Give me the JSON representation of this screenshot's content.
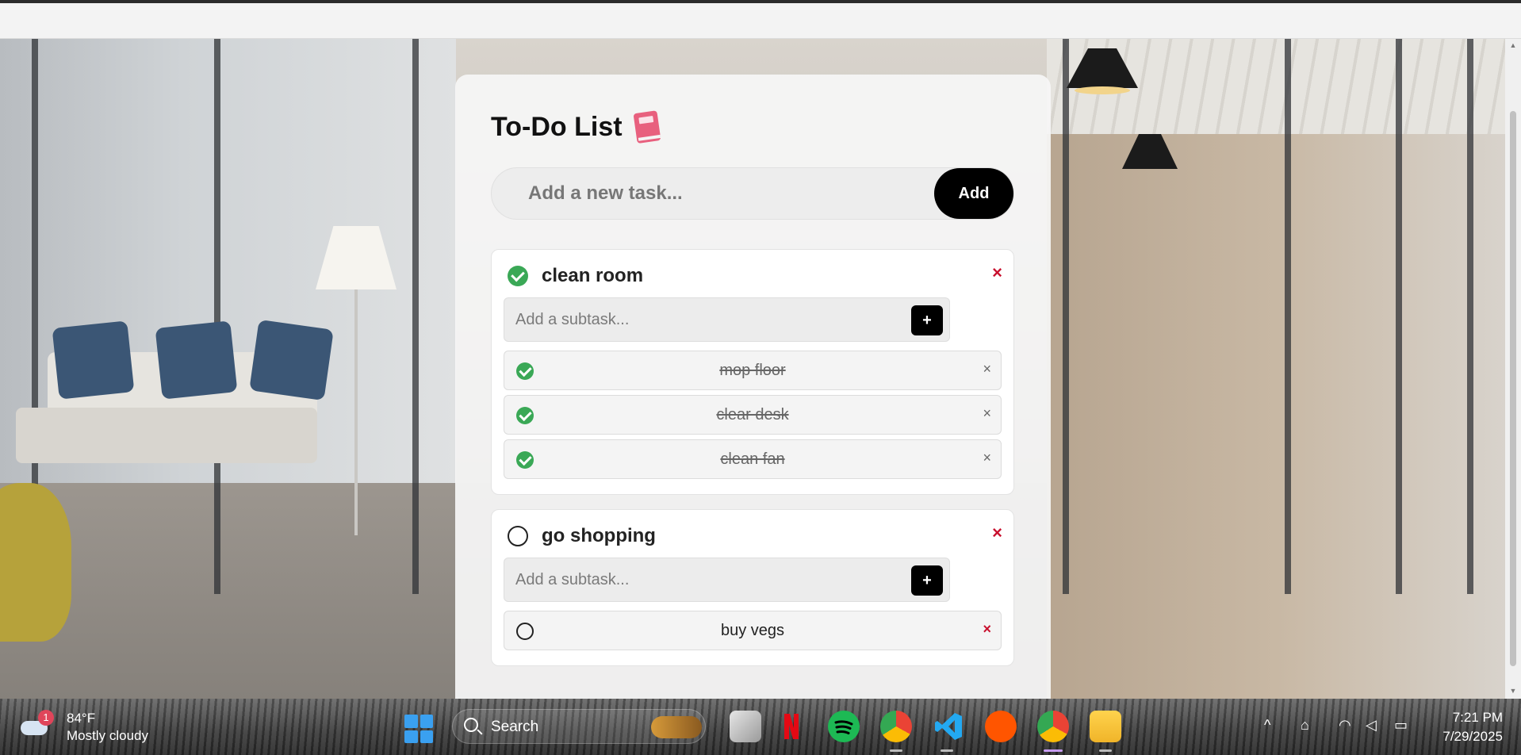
{
  "todo": {
    "title": "To-Do List",
    "title_icon": "notebook-icon",
    "new_task_placeholder": "Add a new task...",
    "add_label": "Add",
    "subtask_placeholder": "Add a subtask...",
    "subtask_add_label": "+",
    "delete_glyph": "×",
    "tasks": [
      {
        "name": "clean room",
        "done": true,
        "subtasks": [
          {
            "name": "mop floor",
            "done": true
          },
          {
            "name": "clear desk",
            "done": true
          },
          {
            "name": "clean fan",
            "done": true
          }
        ]
      },
      {
        "name": "go shopping",
        "done": false,
        "subtasks": [
          {
            "name": "buy vegs",
            "done": false
          }
        ]
      }
    ]
  },
  "colors": {
    "check_green": "#3aa856",
    "delete_red": "#c8102e",
    "button_black": "#000000"
  },
  "taskbar": {
    "weather": {
      "temp": "84°F",
      "condition": "Mostly cloudy",
      "badge": "1"
    },
    "search_label": "Search",
    "apps": [
      "start-icon",
      "task-view-icon",
      "netflix-icon",
      "spotify-icon",
      "chrome-profile-icon",
      "vscode-icon",
      "soundcloud-icon",
      "chrome-icon",
      "file-explorer-icon"
    ],
    "tray_icons": [
      "chevron-up-icon",
      "network-icon",
      "wifi-icon",
      "volume-icon",
      "battery-icon"
    ],
    "time": "7:21 PM",
    "date": "7/29/2025"
  }
}
